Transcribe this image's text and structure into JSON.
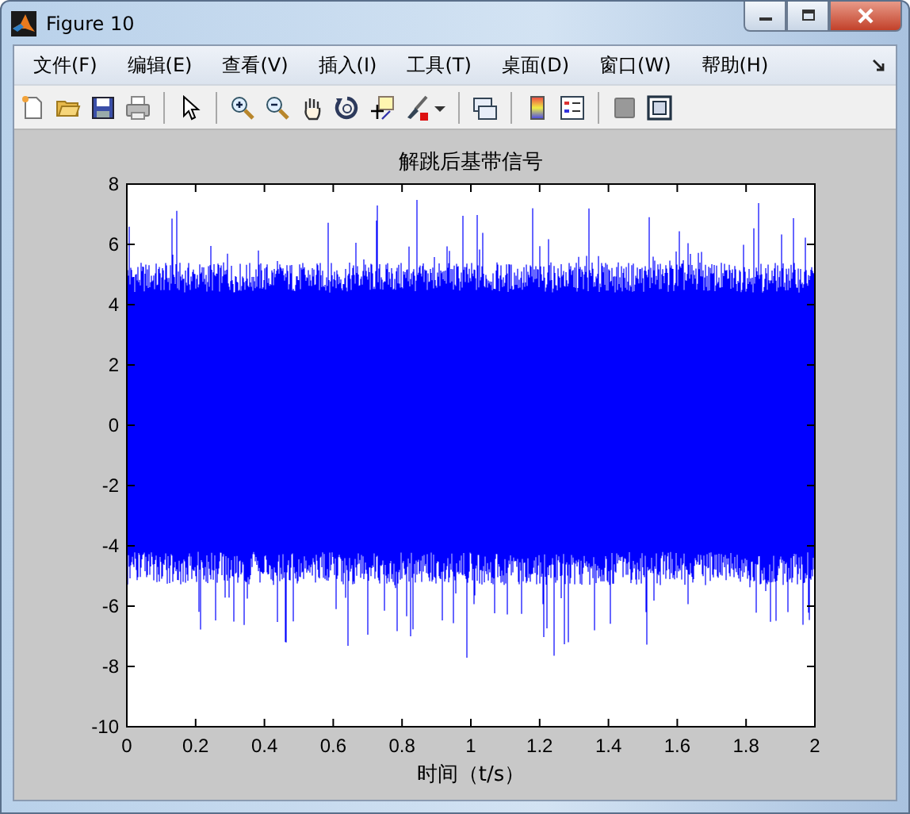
{
  "window": {
    "title": "Figure 10"
  },
  "menu": [
    "文件(F)",
    "编辑(E)",
    "查看(V)",
    "插入(I)",
    "工具(T)",
    "桌面(D)",
    "窗口(W)",
    "帮助(H)"
  ],
  "plot": {
    "title": "解跳后基带信号",
    "xlabel": "时间（t/s）",
    "xticks": [
      "0",
      "0.2",
      "0.4",
      "0.6",
      "0.8",
      "1",
      "1.2",
      "1.4",
      "1.6",
      "1.8",
      "2"
    ],
    "yticks": [
      "8",
      "6",
      "4",
      "2",
      "0",
      "-2",
      "-4",
      "-6",
      "-8",
      "-10"
    ]
  }
}
